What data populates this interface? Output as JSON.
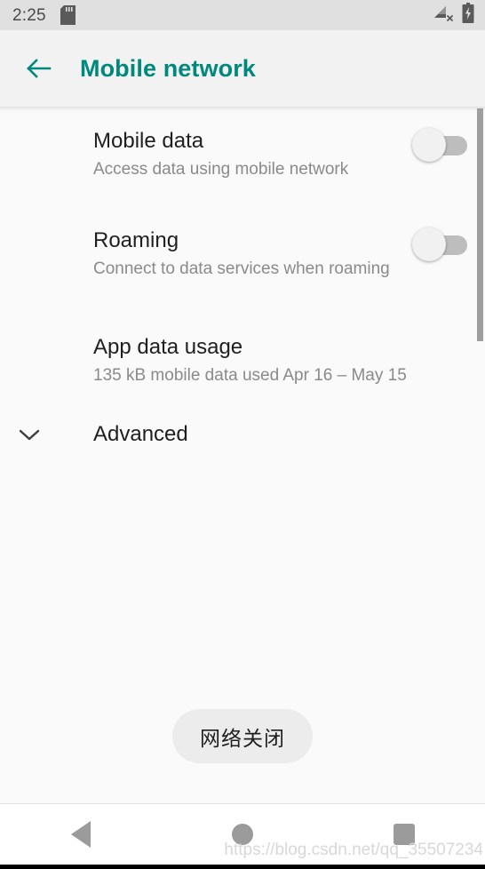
{
  "status_bar": {
    "clock": "2:25",
    "icons": [
      "sd-card-icon",
      "signal-no-service-icon",
      "battery-charging-icon"
    ]
  },
  "app_bar": {
    "back_icon": "arrow-left-icon",
    "title": "Mobile network",
    "accent_color": "#00897b"
  },
  "preferences": [
    {
      "key": "mobile_data",
      "title": "Mobile data",
      "summary": "Access data using mobile network",
      "control": "switch",
      "checked": false
    },
    {
      "key": "roaming",
      "title": "Roaming",
      "summary": "Connect to data services when roaming",
      "control": "switch",
      "checked": false
    },
    {
      "key": "app_data_usage",
      "title": "App data usage",
      "summary": "135 kB mobile data used Apr 16 – May 15",
      "control": "none"
    },
    {
      "key": "advanced",
      "title": "Advanced",
      "icon": "chevron-down-icon",
      "control": "expander"
    }
  ],
  "toast": {
    "text": "网络关闭",
    "background": "#ececec"
  },
  "nav_bar": {
    "back": "nav-back-icon",
    "home": "nav-home-icon",
    "recents": "nav-recents-icon"
  },
  "watermark": {
    "text": "https://blog.csdn.net/qq_35507234"
  }
}
